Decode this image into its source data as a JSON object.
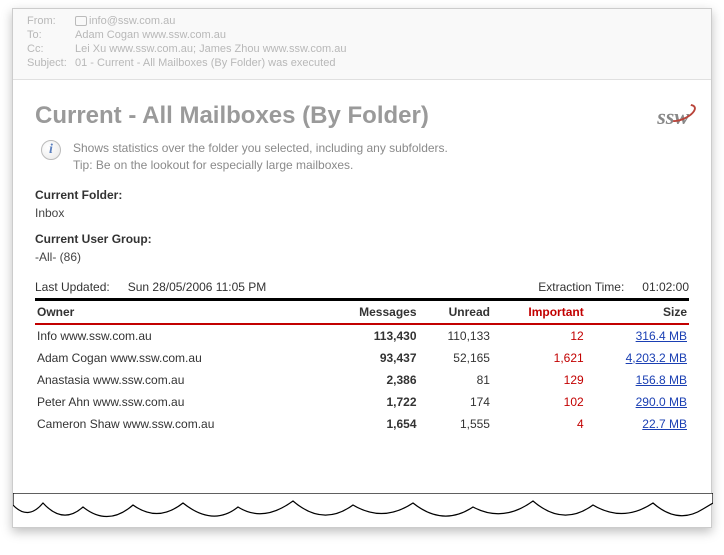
{
  "email_header": {
    "from_label": "From:",
    "from_value": "info@ssw.com.au",
    "to_label": "To:",
    "to_value": "Adam Cogan www.ssw.com.au",
    "cc_label": "Cc:",
    "cc_value": "Lei Xu www.ssw.com.au; James Zhou www.ssw.com.au",
    "subject_label": "Subject:",
    "subject_value": "01 - Current - All Mailboxes (By Folder) was executed"
  },
  "title": "Current - All Mailboxes (By Folder)",
  "logo_text": "ssw",
  "info_line1": "Shows statistics over the folder you selected, including any subfolders.",
  "info_line2": "Tip: Be on the lookout for especially large mailboxes.",
  "meta": {
    "folder_label": "Current Folder:",
    "folder_value": "Inbox",
    "group_label": "Current User Group:",
    "group_value": "-All- (86)"
  },
  "update": {
    "last_updated_label": "Last Updated:",
    "last_updated_value": "Sun 28/05/2006 11:05 PM",
    "extraction_label": "Extraction Time:",
    "extraction_value": "01:02:00"
  },
  "columns": {
    "owner": "Owner",
    "messages": "Messages",
    "unread": "Unread",
    "important": "Important",
    "size": "Size"
  },
  "rows": [
    {
      "owner": "Info www.ssw.com.au",
      "messages": "113,430",
      "unread": "110,133",
      "important": "12",
      "size": "316.4 MB"
    },
    {
      "owner": "Adam Cogan www.ssw.com.au",
      "messages": "93,437",
      "unread": "52,165",
      "important": "1,621",
      "size": "4,203.2 MB"
    },
    {
      "owner": "Anastasia www.ssw.com.au",
      "messages": "2,386",
      "unread": "81",
      "important": "129",
      "size": "156.8 MB"
    },
    {
      "owner": "Peter Ahn www.ssw.com.au",
      "messages": "1,722",
      "unread": "174",
      "important": "102",
      "size": "290.0 MB"
    },
    {
      "owner": "Cameron Shaw www.ssw.com.au",
      "messages": "1,654",
      "unread": "1,555",
      "important": "4",
      "size": "22.7 MB"
    }
  ]
}
